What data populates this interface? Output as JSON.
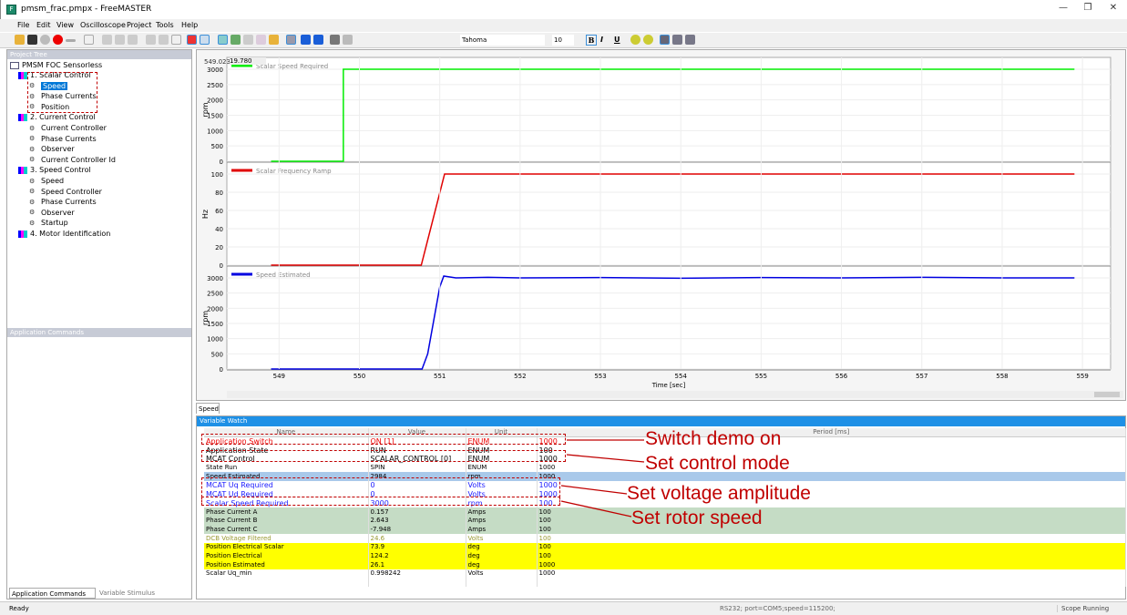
{
  "window": {
    "title": "pmsm_frac.pmpx - FreeMASTER",
    "minimize": "—",
    "maximize": "❐",
    "close": "✕"
  },
  "menu": [
    "File",
    "Edit",
    "View",
    "Oscilloscope",
    "Project",
    "Tools",
    "Help"
  ],
  "format_toolbar": {
    "font": "Tahoma",
    "size": "10",
    "bold": "B",
    "italic": "I",
    "underline": "U"
  },
  "project_tree": {
    "title": "Project Tree",
    "root": "PMSM FOC Sensorless",
    "items": [
      {
        "label": "1. Scalar Control",
        "level": 0
      },
      {
        "label": "Speed",
        "level": 1,
        "selected": true
      },
      {
        "label": "Phase Currents",
        "level": 1
      },
      {
        "label": "Position",
        "level": 1
      },
      {
        "label": "2. Current Control",
        "level": 0
      },
      {
        "label": "Current Controller",
        "level": 1
      },
      {
        "label": "Phase Currents",
        "level": 1
      },
      {
        "label": "Observer",
        "level": 1
      },
      {
        "label": "Current Controller Id",
        "level": 1
      },
      {
        "label": "3. Speed Control",
        "level": 0
      },
      {
        "label": "Speed",
        "level": 1
      },
      {
        "label": "Speed Controller",
        "level": 1
      },
      {
        "label": "Phase Currents",
        "level": 1
      },
      {
        "label": "Observer",
        "level": 1
      },
      {
        "label": "Startup",
        "level": 1
      },
      {
        "label": "4. Motor Identification",
        "level": 0
      }
    ]
  },
  "app_commands": {
    "title": "Application Commands",
    "tabs": [
      "Application Commands",
      "Variable Stimulus"
    ]
  },
  "chart_cursor": {
    "x": "549.023",
    "y": "19.780"
  },
  "chart_data": [
    {
      "type": "line",
      "ylabel": "rpm",
      "ylim": [
        0,
        3000
      ],
      "yticks": [
        0,
        500,
        1000,
        1500,
        2000,
        2500,
        3000
      ],
      "color": "#00ee00",
      "series": [
        {
          "name": "Scalar Speed Required",
          "x": [
            548.9,
            549.8,
            549.8,
            558.9
          ],
          "y": [
            0,
            0,
            3000,
            3000
          ]
        }
      ]
    },
    {
      "type": "line",
      "ylabel": "Hz",
      "ylim": [
        0,
        100
      ],
      "yticks": [
        0,
        20,
        40,
        60,
        80,
        100
      ],
      "color": "#e00000",
      "series": [
        {
          "name": "Scalar Frequency Ramp",
          "x": [
            548.9,
            550.77,
            551.06,
            558.9
          ],
          "y": [
            0,
            0,
            100,
            100
          ]
        }
      ]
    },
    {
      "type": "line",
      "ylabel": "rpm",
      "ylim": [
        0,
        3000
      ],
      "yticks": [
        0,
        500,
        1000,
        1500,
        2000,
        2500,
        3000
      ],
      "color": "#0000e0",
      "series": [
        {
          "name": "Speed Estimated",
          "x": [
            548.9,
            550.78,
            550.85,
            551.0,
            551.05,
            551.2,
            551.6,
            552.0,
            553.0,
            554.0,
            555.0,
            556.0,
            557.0,
            558.0,
            558.9
          ],
          "y": [
            0,
            0,
            500,
            2700,
            3060,
            3000,
            3020,
            3000,
            3010,
            2990,
            3010,
            3000,
            3020,
            3000,
            3000
          ]
        }
      ]
    }
  ],
  "x_axis": {
    "label": "Time [sec]",
    "xlim": [
      548.35,
      559.35
    ],
    "ticks": [
      549,
      550,
      551,
      552,
      553,
      554,
      555,
      556,
      557,
      558,
      559
    ]
  },
  "scope_tab": "Speed",
  "watch": {
    "title": "Variable Watch",
    "columns": [
      "Name",
      "Value",
      "Unit",
      "Period [ms]"
    ],
    "rows": [
      {
        "name": "Application Switch",
        "value": "ON [1]",
        "unit": "ENUM",
        "period": "1000",
        "style": "red"
      },
      {
        "name": "Application State",
        "value": "RUN",
        "unit": "ENUM",
        "period": "100",
        "style": "bold"
      },
      {
        "name": "MCAT Control",
        "value": "SCALAR_CONTROL [0]",
        "unit": "ENUM",
        "period": "1000",
        "style": "big"
      },
      {
        "name": "State Run",
        "value": "SPIN",
        "unit": "ENUM",
        "period": "1000",
        "style": ""
      },
      {
        "name": "Speed Estimated",
        "value": "2984",
        "unit": "rpm",
        "period": "1000",
        "style": "selected"
      },
      {
        "name": "MCAT Uq Required",
        "value": "0",
        "unit": "Volts",
        "period": "1000",
        "style": "blue"
      },
      {
        "name": "MCAT Ud Required",
        "value": "0",
        "unit": "Volts",
        "period": "1000",
        "style": "blue"
      },
      {
        "name": "Scalar Speed Required",
        "value": "3000",
        "unit": "rpm",
        "period": "100",
        "style": "blue"
      },
      {
        "name": "Phase Current A",
        "value": "0.157",
        "unit": "Amps",
        "period": "100",
        "style": "green"
      },
      {
        "name": "Phase Current B",
        "value": "2.643",
        "unit": "Amps",
        "period": "100",
        "style": "green"
      },
      {
        "name": "Phase Current C",
        "value": "-7.948",
        "unit": "Amps",
        "period": "100",
        "style": "green"
      },
      {
        "name": "DCB Voltage Filtered",
        "value": "24.6",
        "unit": "Volts",
        "period": "100",
        "style": "olive"
      },
      {
        "name": "Position Electrical Scalar",
        "value": "73.9",
        "unit": "deg",
        "period": "100",
        "style": "yellow"
      },
      {
        "name": "Position Electrical",
        "value": "124.2",
        "unit": "deg",
        "period": "100",
        "style": "yellow"
      },
      {
        "name": "Position Estimated",
        "value": "26.1",
        "unit": "deg",
        "period": "1000",
        "style": "yellow"
      },
      {
        "name": "Scalar Uq_min",
        "value": "0.998242",
        "unit": "Volts",
        "period": "1000",
        "style": ""
      }
    ]
  },
  "annotations": [
    "Switch demo on",
    "Set control mode",
    "Set voltage amplitude",
    "Set rotor speed"
  ],
  "status": {
    "left": "Ready",
    "middle": "RS232; port=COM5;speed=115200;",
    "right": "Scope Running"
  }
}
